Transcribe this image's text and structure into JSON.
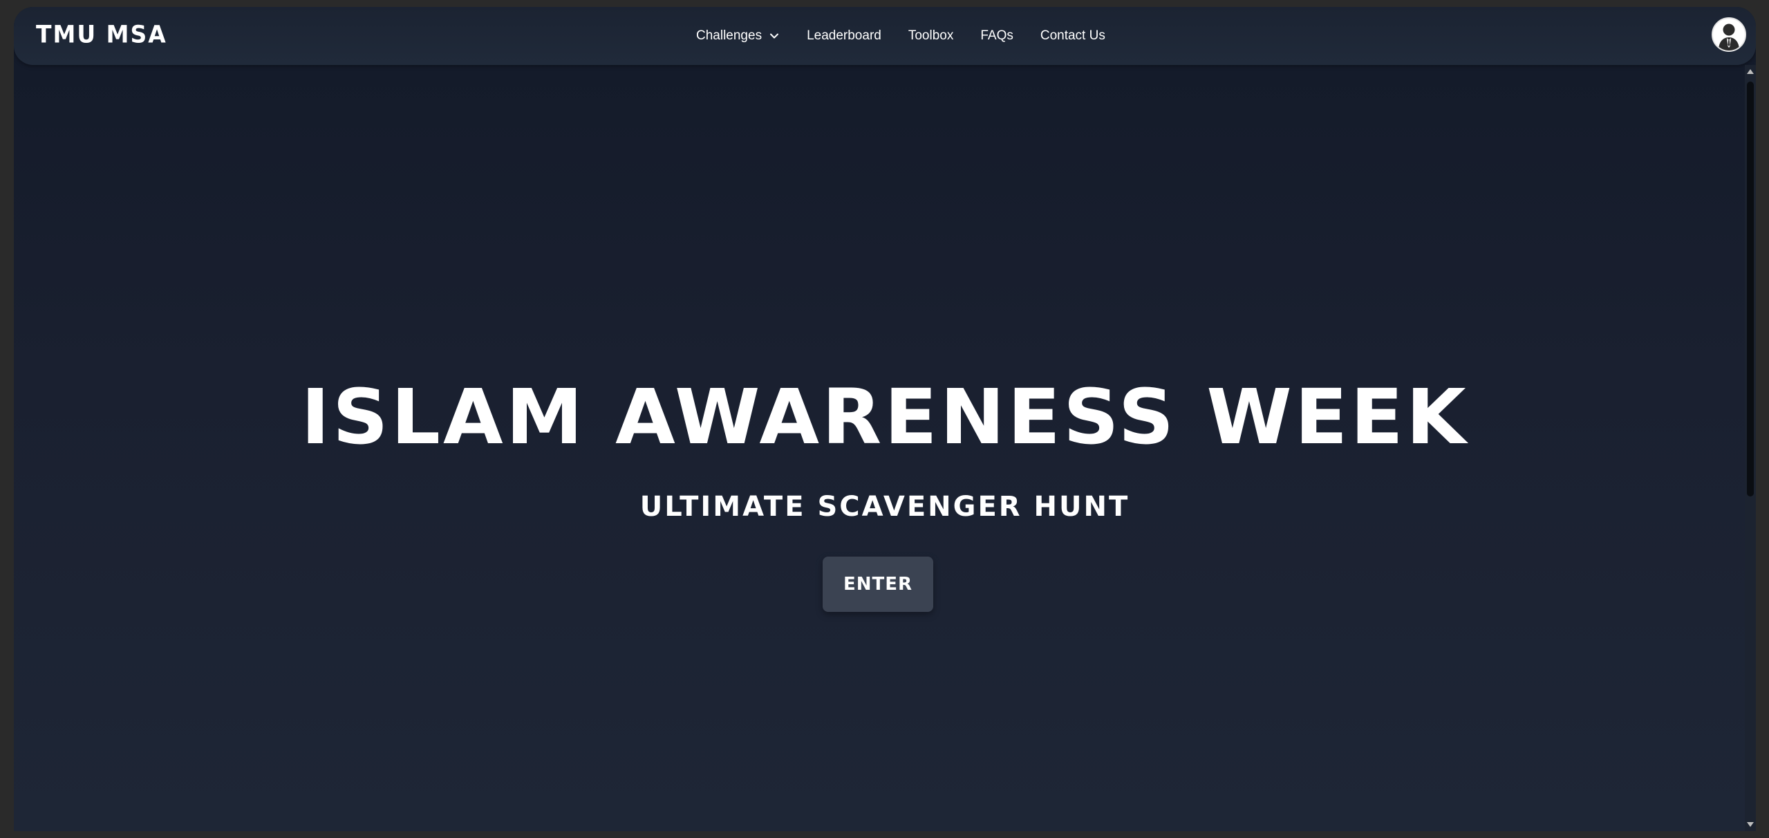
{
  "brand": {
    "name": "TMU MSA"
  },
  "nav": {
    "items": [
      {
        "label": "Challenges",
        "icon": "chevron-down-icon"
      },
      {
        "label": "Leaderboard"
      },
      {
        "label": "Toolbox"
      },
      {
        "label": "FAQs"
      },
      {
        "label": "Contact Us"
      }
    ]
  },
  "user": {
    "avatar_icon": "user-avatar-icon"
  },
  "hero": {
    "title": "ISLAM AWARENESS WEEK",
    "subtitle": "ULTIMATE SCAVENGER HUNT",
    "button_label": "ENTER"
  },
  "colors": {
    "background": "#1a2030",
    "navbar": "#1e2736",
    "button": "#3b4352",
    "text": "#ffffff"
  }
}
